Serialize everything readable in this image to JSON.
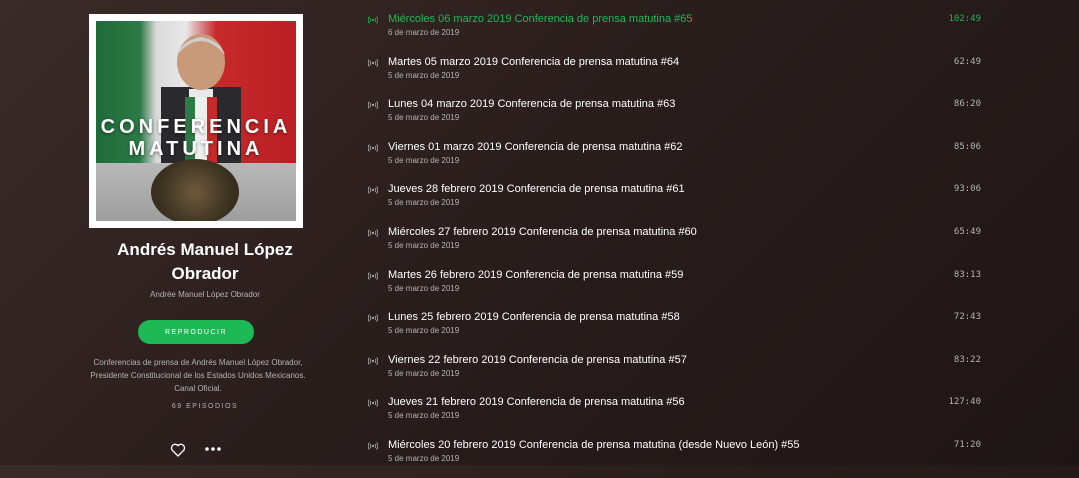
{
  "colors": {
    "accent": "#1db954",
    "muted": "#b3b3b3",
    "text": "#ffffff"
  },
  "podcast": {
    "cover_title_line1": "CONFERENCIA",
    "cover_title_line2": "MATUTINA",
    "name_line1": "Andrés Manuel López",
    "name_line2": "Obrador",
    "publisher": "Andrée Manuel López Obrador",
    "play_label": "REPRODUCIR",
    "description_line1": "Conferencias de prensa de Andrés Manuel López Obrador,",
    "description_line2": "Presidente Constitucional de los Estados Unidos Mexicanos.",
    "description_line3": "Canal Oficial.",
    "episode_count": "69 EPISODIOS"
  },
  "icons": {
    "heart": "heart-icon",
    "more": "more-icon",
    "broadcast": "broadcast-icon"
  },
  "episodes": [
    {
      "title": "Miércoles 06 marzo 2019 Conferencia de prensa matutina #65",
      "date": "6 de marzo de 2019",
      "duration": "102:49",
      "active": true
    },
    {
      "title": "Martes 05 marzo 2019 Conferencia de prensa matutina #64",
      "date": "5 de marzo de 2019",
      "duration": "62:49"
    },
    {
      "title": "Lunes 04 marzo 2019 Conferencia de prensa matutina #63",
      "date": "5 de marzo de 2019",
      "duration": "86:20"
    },
    {
      "title": "Viernes 01 marzo 2019 Conferencia de prensa matutina #62",
      "date": "5 de marzo de 2019",
      "duration": "85:06"
    },
    {
      "title": "Jueves 28 febrero 2019 Conferencia de prensa matutina #61",
      "date": "5 de marzo de 2019",
      "duration": "93:06"
    },
    {
      "title": "Miércoles 27 febrero 2019 Conferencia de prensa matutina #60",
      "date": "5 de marzo de 2019",
      "duration": "65:49"
    },
    {
      "title": "Martes 26 febrero 2019 Conferencia de prensa matutina #59",
      "date": "5 de marzo de 2019",
      "duration": "83:13"
    },
    {
      "title": "Lunes 25 febrero 2019 Conferencia de prensa matutina #58",
      "date": "5 de marzo de 2019",
      "duration": "72:43"
    },
    {
      "title": "Viernes 22 febrero 2019 Conferencia de prensa matutina #57",
      "date": "5 de marzo de 2019",
      "duration": "83:22"
    },
    {
      "title": "Jueves 21 febrero 2019 Conferencia de prensa matutina #56",
      "date": "5 de marzo de 2019",
      "duration": "127:40"
    },
    {
      "title": "Miércoles 20 febrero 2019 Conferencia de prensa matutina (desde Nuevo León) #55",
      "date": "5 de marzo de 2019",
      "duration": "71:20"
    }
  ]
}
